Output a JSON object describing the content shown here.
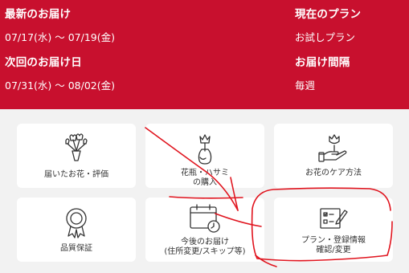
{
  "header": {
    "latest_delivery": {
      "label": "最新のお届け",
      "value": "07/17(水) 〜 07/19(金)"
    },
    "current_plan": {
      "label": "現在のプラン",
      "value": "お試しプラン"
    },
    "next_delivery": {
      "label": "次回のお届け日",
      "value": "07/31(水) 〜 08/02(金)"
    },
    "delivery_interval": {
      "label": "お届け間隔",
      "value": "毎週"
    }
  },
  "menu": [
    {
      "label": "届いたお花・評価",
      "icon": "bouquet-icon"
    },
    {
      "label": "花瓶・ハサミ\nの購入",
      "icon": "vase-icon"
    },
    {
      "label": "お花のケア方法",
      "icon": "hand-flower-icon"
    },
    {
      "label": "品質保証",
      "icon": "award-ribbon-icon"
    },
    {
      "label": "今後のお届け\n(住所変更/スキップ等)",
      "icon": "calendar-clock-icon"
    },
    {
      "label": "プラン・登録情報\n確認/変更",
      "icon": "form-edit-icon"
    }
  ],
  "colors": {
    "brand": "#c8102e",
    "annotation": "#e0141e"
  }
}
